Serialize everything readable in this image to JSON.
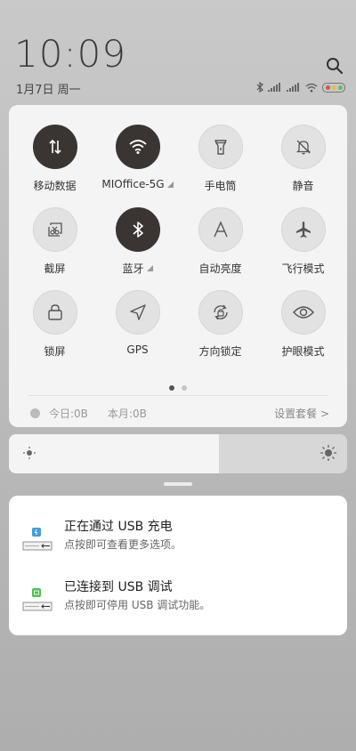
{
  "header": {
    "time": "10:09",
    "date": "1月7日 周一"
  },
  "colors": {
    "tile_on": "#3a3532",
    "tile_off": "#e2e2e2",
    "battery_dots": [
      "#e05050",
      "#e0c040",
      "#60c060"
    ]
  },
  "quick_settings": {
    "tiles": [
      {
        "label": "移动数据",
        "icon": "mobile-data-icon",
        "active": true
      },
      {
        "label": "MIOffice-5G",
        "icon": "wifi-icon",
        "active": true
      },
      {
        "label": "手电筒",
        "icon": "flashlight-icon",
        "active": false
      },
      {
        "label": "静音",
        "icon": "mute-bell-icon",
        "active": false
      },
      {
        "label": "截屏",
        "icon": "screenshot-icon",
        "active": false
      },
      {
        "label": "蓝牙",
        "icon": "bluetooth-icon",
        "active": true
      },
      {
        "label": "自动亮度",
        "icon": "auto-brightness-icon",
        "active": false
      },
      {
        "label": "飞行模式",
        "icon": "airplane-icon",
        "active": false
      },
      {
        "label": "锁屏",
        "icon": "lock-icon",
        "active": false
      },
      {
        "label": "GPS",
        "icon": "gps-icon",
        "active": false
      },
      {
        "label": "方向锁定",
        "icon": "rotation-lock-icon",
        "active": false
      },
      {
        "label": "护眼模式",
        "icon": "eye-icon",
        "active": false
      }
    ],
    "page_count": 2,
    "current_page": 1
  },
  "usage": {
    "today": "今日:0B",
    "month": "本月:0B",
    "settings_link": "设置套餐 >"
  },
  "brightness": {
    "level": 0.62
  },
  "notifications": [
    {
      "title": "正在通过 USB 充电",
      "subtitle": "点按即可查看更多选项。",
      "icon": "usb-charge-icon",
      "icon_color": "#3d9ee0"
    },
    {
      "title": "已连接到 USB 调试",
      "subtitle": "点按即可停用 USB 调试功能。",
      "icon": "usb-debug-icon",
      "icon_color": "#50c050"
    }
  ]
}
